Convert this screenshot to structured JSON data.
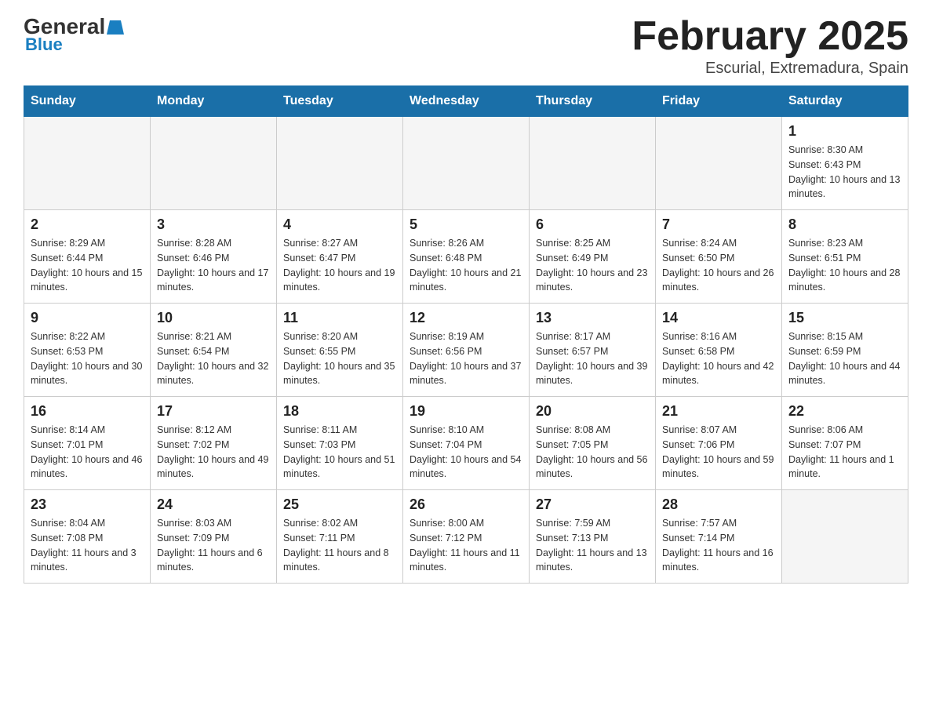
{
  "header": {
    "logo_general": "General",
    "logo_blue": "Blue",
    "title": "February 2025",
    "location": "Escurial, Extremadura, Spain"
  },
  "days_of_week": [
    "Sunday",
    "Monday",
    "Tuesday",
    "Wednesday",
    "Thursday",
    "Friday",
    "Saturday"
  ],
  "weeks": [
    [
      {
        "day": "",
        "empty": true
      },
      {
        "day": "",
        "empty": true
      },
      {
        "day": "",
        "empty": true
      },
      {
        "day": "",
        "empty": true
      },
      {
        "day": "",
        "empty": true
      },
      {
        "day": "",
        "empty": true
      },
      {
        "day": "1",
        "sunrise": "Sunrise: 8:30 AM",
        "sunset": "Sunset: 6:43 PM",
        "daylight": "Daylight: 10 hours and 13 minutes."
      }
    ],
    [
      {
        "day": "2",
        "sunrise": "Sunrise: 8:29 AM",
        "sunset": "Sunset: 6:44 PM",
        "daylight": "Daylight: 10 hours and 15 minutes."
      },
      {
        "day": "3",
        "sunrise": "Sunrise: 8:28 AM",
        "sunset": "Sunset: 6:46 PM",
        "daylight": "Daylight: 10 hours and 17 minutes."
      },
      {
        "day": "4",
        "sunrise": "Sunrise: 8:27 AM",
        "sunset": "Sunset: 6:47 PM",
        "daylight": "Daylight: 10 hours and 19 minutes."
      },
      {
        "day": "5",
        "sunrise": "Sunrise: 8:26 AM",
        "sunset": "Sunset: 6:48 PM",
        "daylight": "Daylight: 10 hours and 21 minutes."
      },
      {
        "day": "6",
        "sunrise": "Sunrise: 8:25 AM",
        "sunset": "Sunset: 6:49 PM",
        "daylight": "Daylight: 10 hours and 23 minutes."
      },
      {
        "day": "7",
        "sunrise": "Sunrise: 8:24 AM",
        "sunset": "Sunset: 6:50 PM",
        "daylight": "Daylight: 10 hours and 26 minutes."
      },
      {
        "day": "8",
        "sunrise": "Sunrise: 8:23 AM",
        "sunset": "Sunset: 6:51 PM",
        "daylight": "Daylight: 10 hours and 28 minutes."
      }
    ],
    [
      {
        "day": "9",
        "sunrise": "Sunrise: 8:22 AM",
        "sunset": "Sunset: 6:53 PM",
        "daylight": "Daylight: 10 hours and 30 minutes."
      },
      {
        "day": "10",
        "sunrise": "Sunrise: 8:21 AM",
        "sunset": "Sunset: 6:54 PM",
        "daylight": "Daylight: 10 hours and 32 minutes."
      },
      {
        "day": "11",
        "sunrise": "Sunrise: 8:20 AM",
        "sunset": "Sunset: 6:55 PM",
        "daylight": "Daylight: 10 hours and 35 minutes."
      },
      {
        "day": "12",
        "sunrise": "Sunrise: 8:19 AM",
        "sunset": "Sunset: 6:56 PM",
        "daylight": "Daylight: 10 hours and 37 minutes."
      },
      {
        "day": "13",
        "sunrise": "Sunrise: 8:17 AM",
        "sunset": "Sunset: 6:57 PM",
        "daylight": "Daylight: 10 hours and 39 minutes."
      },
      {
        "day": "14",
        "sunrise": "Sunrise: 8:16 AM",
        "sunset": "Sunset: 6:58 PM",
        "daylight": "Daylight: 10 hours and 42 minutes."
      },
      {
        "day": "15",
        "sunrise": "Sunrise: 8:15 AM",
        "sunset": "Sunset: 6:59 PM",
        "daylight": "Daylight: 10 hours and 44 minutes."
      }
    ],
    [
      {
        "day": "16",
        "sunrise": "Sunrise: 8:14 AM",
        "sunset": "Sunset: 7:01 PM",
        "daylight": "Daylight: 10 hours and 46 minutes."
      },
      {
        "day": "17",
        "sunrise": "Sunrise: 8:12 AM",
        "sunset": "Sunset: 7:02 PM",
        "daylight": "Daylight: 10 hours and 49 minutes."
      },
      {
        "day": "18",
        "sunrise": "Sunrise: 8:11 AM",
        "sunset": "Sunset: 7:03 PM",
        "daylight": "Daylight: 10 hours and 51 minutes."
      },
      {
        "day": "19",
        "sunrise": "Sunrise: 8:10 AM",
        "sunset": "Sunset: 7:04 PM",
        "daylight": "Daylight: 10 hours and 54 minutes."
      },
      {
        "day": "20",
        "sunrise": "Sunrise: 8:08 AM",
        "sunset": "Sunset: 7:05 PM",
        "daylight": "Daylight: 10 hours and 56 minutes."
      },
      {
        "day": "21",
        "sunrise": "Sunrise: 8:07 AM",
        "sunset": "Sunset: 7:06 PM",
        "daylight": "Daylight: 10 hours and 59 minutes."
      },
      {
        "day": "22",
        "sunrise": "Sunrise: 8:06 AM",
        "sunset": "Sunset: 7:07 PM",
        "daylight": "Daylight: 11 hours and 1 minute."
      }
    ],
    [
      {
        "day": "23",
        "sunrise": "Sunrise: 8:04 AM",
        "sunset": "Sunset: 7:08 PM",
        "daylight": "Daylight: 11 hours and 3 minutes."
      },
      {
        "day": "24",
        "sunrise": "Sunrise: 8:03 AM",
        "sunset": "Sunset: 7:09 PM",
        "daylight": "Daylight: 11 hours and 6 minutes."
      },
      {
        "day": "25",
        "sunrise": "Sunrise: 8:02 AM",
        "sunset": "Sunset: 7:11 PM",
        "daylight": "Daylight: 11 hours and 8 minutes."
      },
      {
        "day": "26",
        "sunrise": "Sunrise: 8:00 AM",
        "sunset": "Sunset: 7:12 PM",
        "daylight": "Daylight: 11 hours and 11 minutes."
      },
      {
        "day": "27",
        "sunrise": "Sunrise: 7:59 AM",
        "sunset": "Sunset: 7:13 PM",
        "daylight": "Daylight: 11 hours and 13 minutes."
      },
      {
        "day": "28",
        "sunrise": "Sunrise: 7:57 AM",
        "sunset": "Sunset: 7:14 PM",
        "daylight": "Daylight: 11 hours and 16 minutes."
      },
      {
        "day": "",
        "empty": true
      }
    ]
  ]
}
